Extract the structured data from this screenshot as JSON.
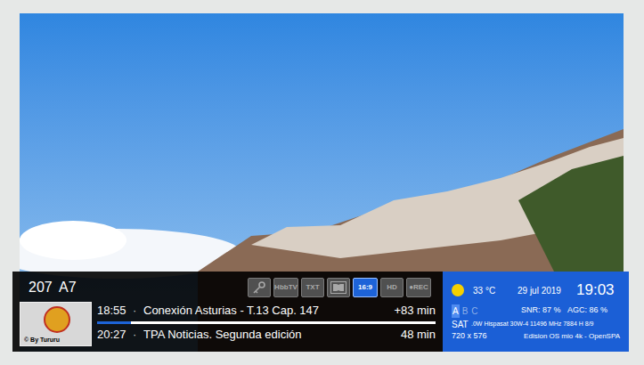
{
  "channel": {
    "number": "207",
    "name": "A7"
  },
  "picon": {
    "caption": "© By Tururu"
  },
  "indicators": [
    {
      "kind": "key",
      "label": "",
      "active": false
    },
    {
      "kind": "badge",
      "label": "HbbTV",
      "active": false
    },
    {
      "kind": "badge",
      "label": "TXT",
      "active": false
    },
    {
      "kind": "dolby",
      "label": "",
      "active": false
    },
    {
      "kind": "badge",
      "label": "16:9",
      "active": true
    },
    {
      "kind": "badge",
      "label": "HD",
      "active": false
    },
    {
      "kind": "badge",
      "label": "●REC",
      "active": false
    }
  ],
  "events": [
    {
      "time": "18:55",
      "separator": "·",
      "title": "Conexión Asturias - T.13 Cap. 147",
      "duration": "+83 min"
    },
    {
      "time": "20:27",
      "separator": "·",
      "title": "TPA Noticias. Segunda edición",
      "duration": "48 min"
    }
  ],
  "progress": {
    "level": 0.1
  },
  "weather": {
    "temperature": "33 °C",
    "date": "29 jul 2019",
    "clock": "19:03"
  },
  "tuners": [
    {
      "label": "A",
      "selected": true
    },
    {
      "label": "B",
      "selected": false
    },
    {
      "label": "C",
      "selected": false
    }
  ],
  "signal": {
    "snr": "SNR: 87 %",
    "agc": "AGC: 86 %"
  },
  "satellite": {
    "label": "SAT",
    "info": ".0W Hispasat 30W-4 11496 MHz 7884 H 8/9"
  },
  "resolution": "720 x 576",
  "receiver": "Edision OS mio 4k - OpenSPA"
}
